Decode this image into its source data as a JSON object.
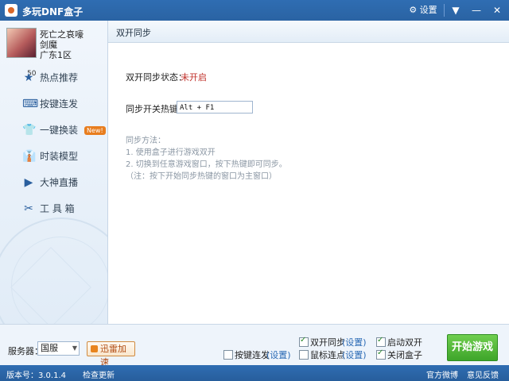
{
  "titlebar": {
    "title": "多玩DNF盒子",
    "settings_label": "⚙ 设置",
    "menu_glyph": "▼",
    "minimize_glyph": "—",
    "close_glyph": "✕"
  },
  "user": {
    "name": "死亡之哀嚎",
    "class": "剑魔",
    "server": "广东1区",
    "level": "50"
  },
  "sidebar": {
    "items": [
      {
        "label": "热点推荐",
        "icon": "star-icon",
        "glyph": "★"
      },
      {
        "label": "按键连发",
        "icon": "keyboard-icon",
        "glyph": "⌨"
      },
      {
        "label": "一键换装",
        "icon": "outfit-icon",
        "glyph": "👕",
        "badge": "New!"
      },
      {
        "label": "时装模型",
        "icon": "tshirt-icon",
        "glyph": "👔"
      },
      {
        "label": "大神直播",
        "icon": "play-icon",
        "glyph": "▶"
      },
      {
        "label": "工 具 箱",
        "icon": "tools-icon",
        "glyph": "✂"
      }
    ]
  },
  "panel": {
    "header": "双开同步",
    "status_label": "双开同步状态：",
    "status_value": "未开启",
    "hotkey_label": "同步开关热键：",
    "hotkey_value": "Alt + F1",
    "instructions": [
      "同步方法：",
      "1. 使用盒子进行游戏双开",
      "2. 切换到任意游戏窗口，按下热键即可同步。",
      "（注：按下开始同步热键的窗口为主窗口）"
    ]
  },
  "bottom": {
    "server_label": "服务器：",
    "server_value": "国服",
    "xunlei_label": "迅雷加速",
    "options": [
      {
        "label": "按键连发",
        "link": "(设置)",
        "checked": false
      },
      {
        "label": "双开同步",
        "link": "(设置)",
        "checked": true
      },
      {
        "label": "鼠标连点",
        "link": "(设置)",
        "checked": false
      },
      {
        "label": "启动双开",
        "checked": true
      },
      {
        "label": "关闭盒子",
        "checked": true
      }
    ],
    "start_label": "开始游戏"
  },
  "status": {
    "version": "版本号：3.0.1.4",
    "check_update": "检查更新",
    "weibo": "官方微博",
    "feedback": "意见反馈"
  },
  "colors": {
    "titlebar": "#2f6db2",
    "status_off": "#c0302a",
    "start_button": "#4cb535",
    "link": "#2a6ab5"
  }
}
